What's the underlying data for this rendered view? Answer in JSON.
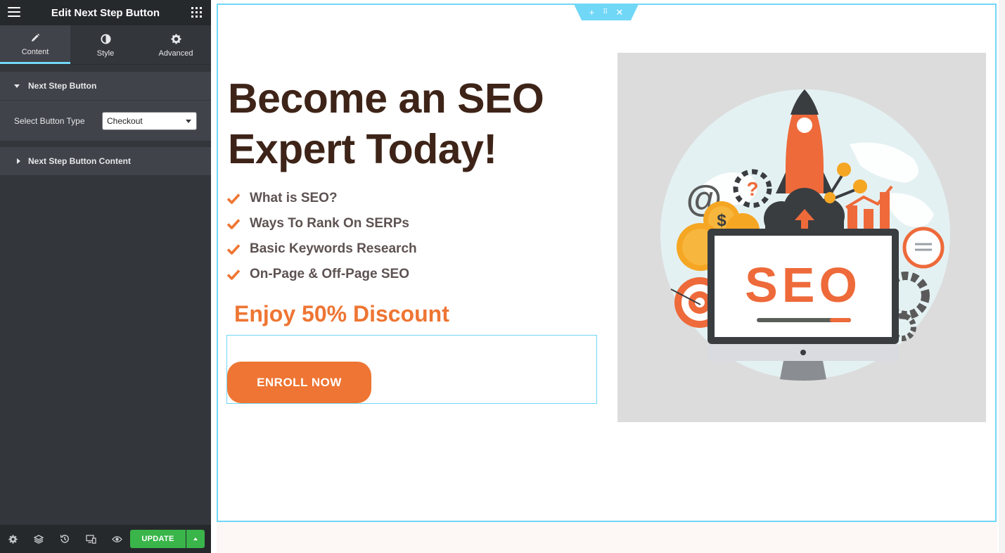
{
  "panel": {
    "title": "Edit Next Step Button",
    "tabs": [
      {
        "label": "Content",
        "icon": "pencil-icon",
        "active": true
      },
      {
        "label": "Style",
        "icon": "contrast-icon",
        "active": false
      },
      {
        "label": "Advanced",
        "icon": "gear-icon",
        "active": false
      }
    ],
    "section_1": {
      "label": "Next Step Button",
      "expanded": true
    },
    "control": {
      "label": "Select Button Type",
      "value": "Checkout"
    },
    "section_2": {
      "label": "Next Step Button Content",
      "expanded": false
    },
    "footer": {
      "icons": [
        "settings-icon",
        "layers-icon",
        "history-icon",
        "responsive-icon",
        "preview-icon"
      ],
      "update_label": "UPDATE"
    }
  },
  "canvas": {
    "headline_line1": "Become an SEO",
    "headline_line2": "Expert Today!",
    "features": [
      "What is SEO?",
      "Ways To Rank On SERPs",
      "Basic Keywords Research",
      "On-Page & Off-Page SEO"
    ],
    "discount": "Enjoy 50% Discount",
    "cta_label": "ENROLL NOW",
    "image_text": "SEO",
    "image_coin_symbol": "$",
    "image_at_symbol": "@",
    "image_question_symbol": "?"
  },
  "colors": {
    "accent": "#ee7533",
    "heading": "#3e2418",
    "body_text": "#5e5252",
    "editor_highlight": "#71d7f7",
    "update_green": "#39b54a"
  }
}
